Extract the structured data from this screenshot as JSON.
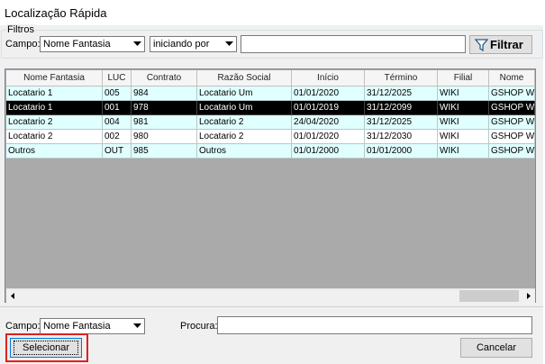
{
  "window": {
    "title": "Localização Rápida"
  },
  "filters": {
    "group_label": "Filtros",
    "campo_label": "Campo:",
    "campo_value": "Nome Fantasia",
    "mode_value": "iniciando por",
    "search_value": "",
    "filter_button": "Filtrar"
  },
  "grid": {
    "columns": [
      "Nome Fantasia",
      "LUC",
      "Contrato",
      "Razão Social",
      "Início",
      "Término",
      "Filial",
      "Nome"
    ],
    "rows": [
      [
        "Locatario 1",
        "005",
        "984",
        "Locatario Um",
        "01/01/2020",
        "31/12/2025",
        "WIKI",
        "GSHOP WIK"
      ],
      [
        "Locatario 1",
        "001",
        "978",
        "Locatario Um",
        "01/01/2019",
        "31/12/2099",
        "WIKI",
        "GSHOP WIK"
      ],
      [
        "Locatario 2",
        "004",
        "981",
        "Locatario 2",
        "24/04/2020",
        "31/12/2025",
        "WIKI",
        "GSHOP WIK"
      ],
      [
        "Locatario 2",
        "002",
        "980",
        "Locatario 2",
        "01/01/2020",
        "31/12/2030",
        "WIKI",
        "GSHOP WIK"
      ],
      [
        "Outros",
        "OUT",
        "985",
        "Outros",
        "01/01/2000",
        "01/01/2000",
        "WIKI",
        "GSHOP WIK"
      ]
    ],
    "selected_row": 1
  },
  "bottom": {
    "campo_label": "Campo:",
    "campo_value": "Nome Fantasia",
    "procura_label": "Procura:",
    "procura_value": "",
    "select_button": "Selecionar",
    "cancel_button": "Cancelar"
  },
  "colors": {
    "row_alt": "#e0ffff",
    "selected_row": "#000000",
    "highlight_box": "#e02020"
  }
}
